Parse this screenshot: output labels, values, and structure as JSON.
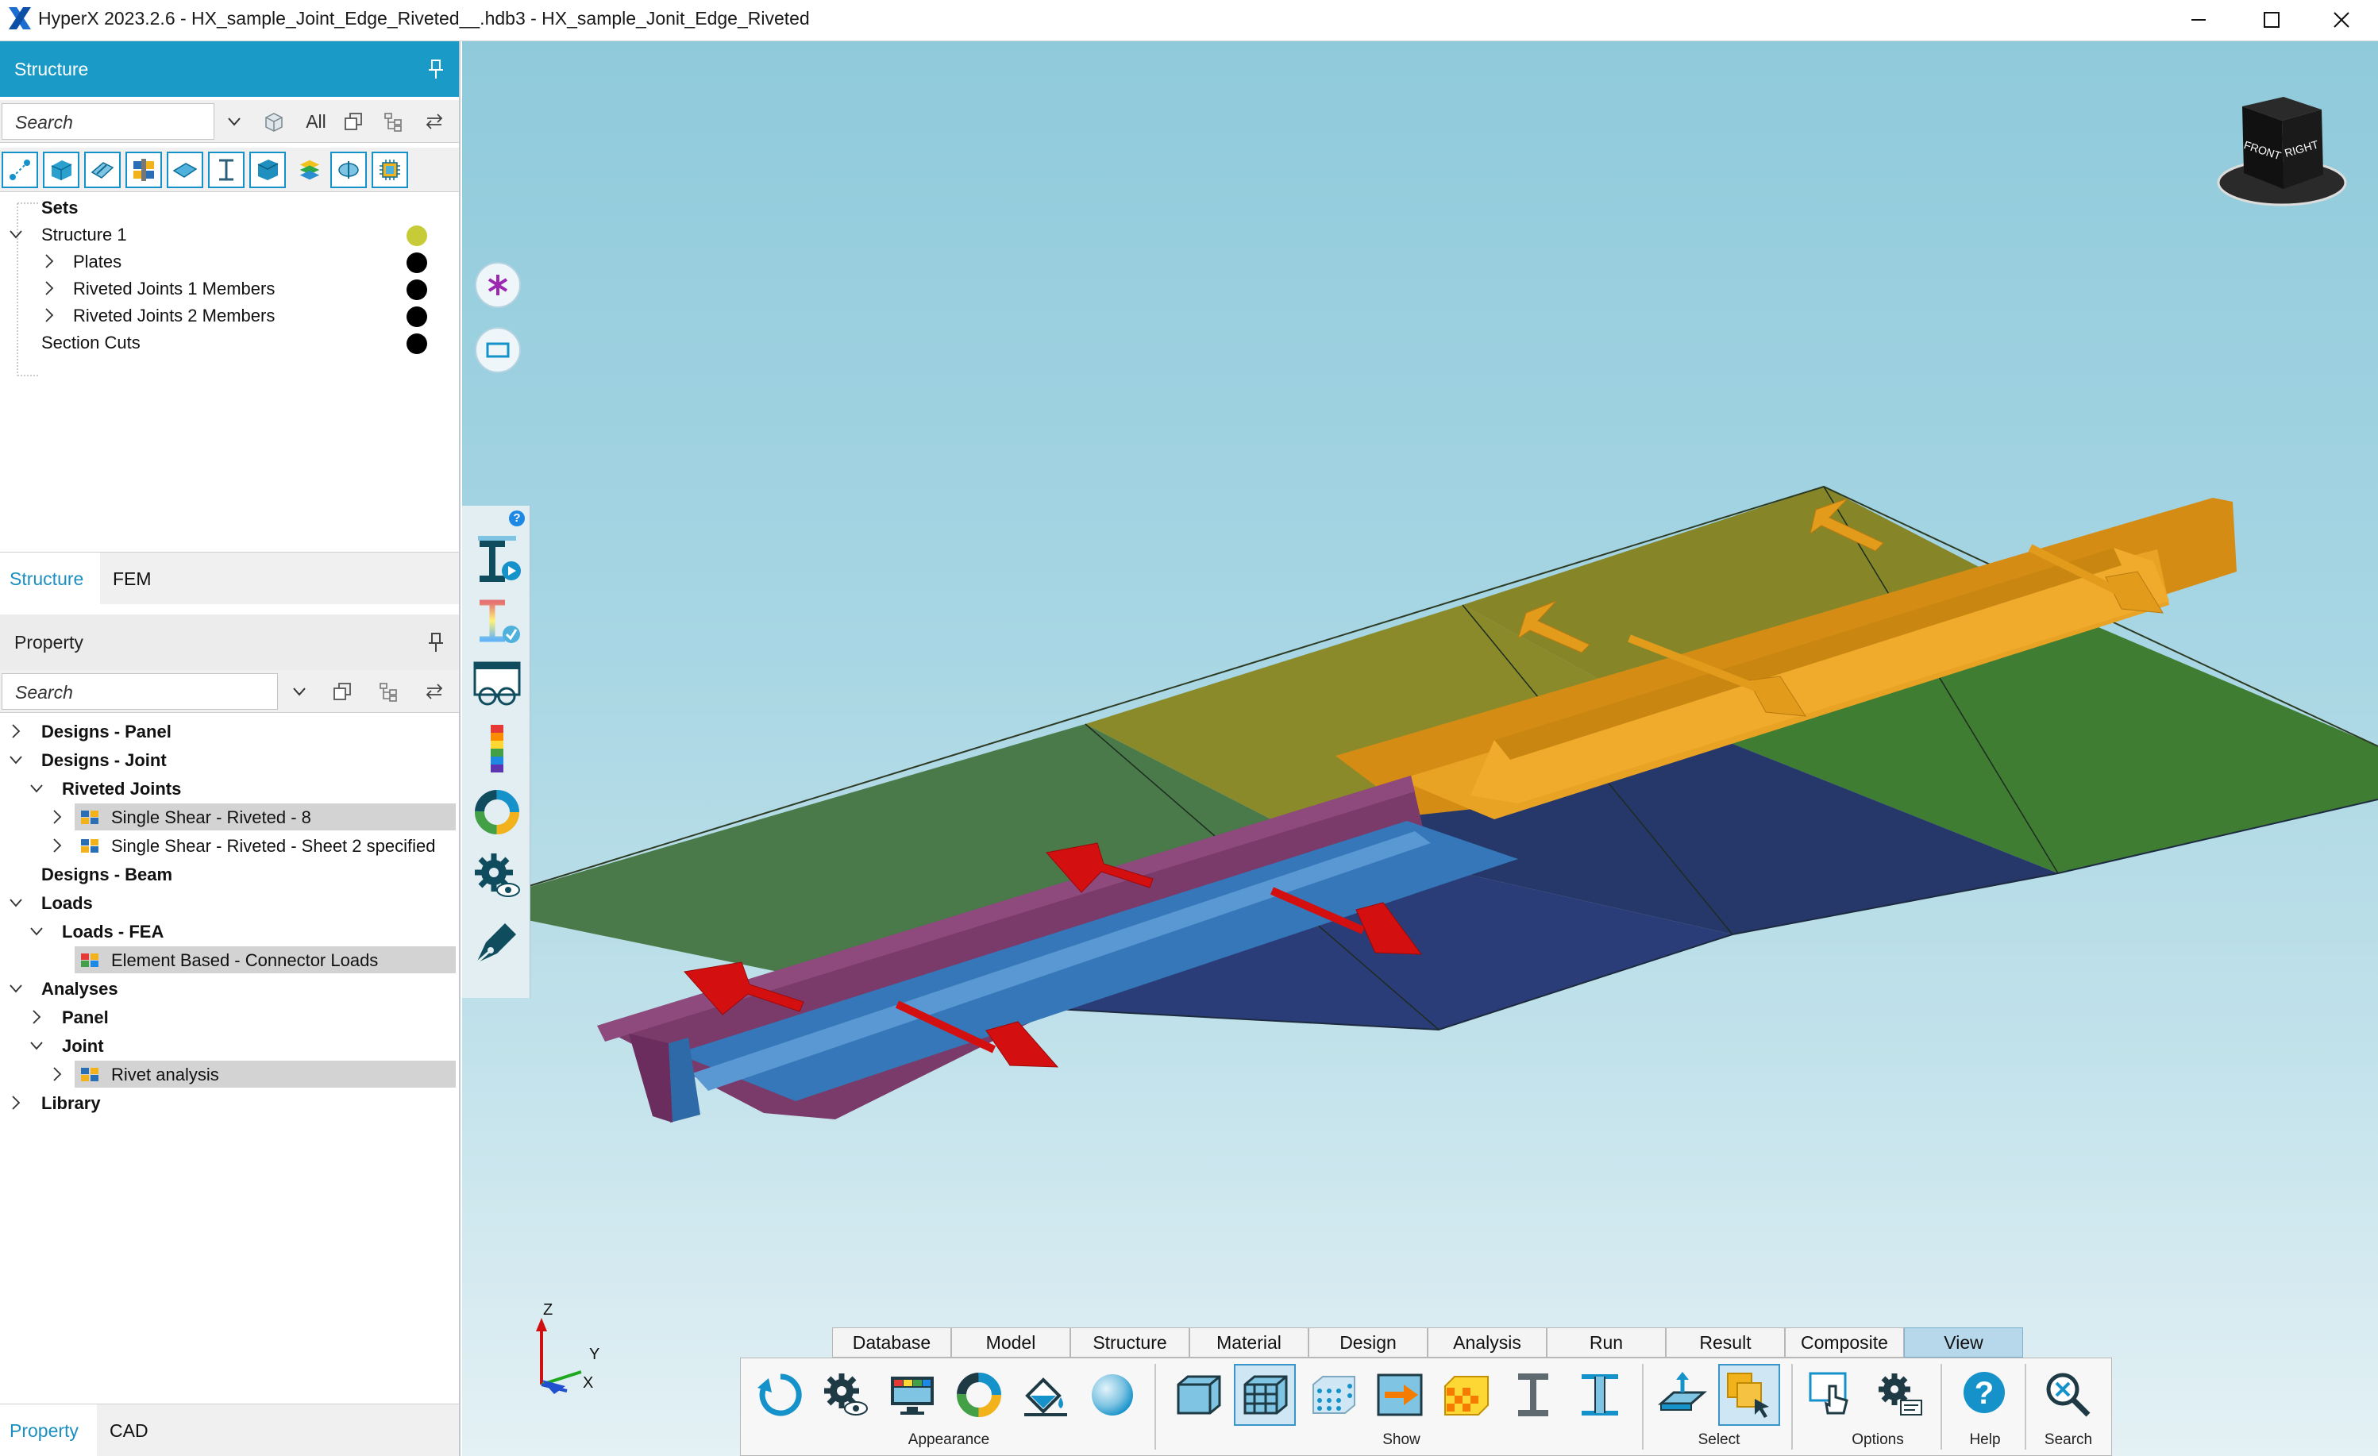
{
  "window": {
    "title": "HyperX 2023.2.6 - HX_sample_Joint_Edge_Riveted__.hdb3 - HX_sample_Jonit_Edge_Riveted"
  },
  "structure_panel": {
    "header": "Structure",
    "search_placeholder": "Search",
    "filter_all": "All",
    "tree": [
      {
        "label": "Sets"
      },
      {
        "label": "Structure 1"
      },
      {
        "label": "Plates"
      },
      {
        "label": "Riveted Joints 1 Members"
      },
      {
        "label": "Riveted Joints 2 Members"
      },
      {
        "label": "Section Cuts"
      }
    ],
    "tabs": [
      "Structure",
      "FEM"
    ]
  },
  "property_panel": {
    "header": "Property",
    "search_placeholder": "Search",
    "tree": [
      {
        "label": "Designs - Panel"
      },
      {
        "label": "Designs - Joint"
      },
      {
        "label": "Riveted Joints"
      },
      {
        "label": "Single Shear - Riveted - 8"
      },
      {
        "label": "Single Shear - Riveted - Sheet 2 specified"
      },
      {
        "label": "Designs - Beam"
      },
      {
        "label": "Loads"
      },
      {
        "label": "Loads - FEA"
      },
      {
        "label": "Element Based - Connector Loads"
      },
      {
        "label": "Analyses"
      },
      {
        "label": "Panel"
      },
      {
        "label": "Joint"
      },
      {
        "label": "Rivet analysis"
      },
      {
        "label": "Library"
      }
    ],
    "tabs": [
      "Property",
      "CAD"
    ]
  },
  "viewport": {
    "view_cube": {
      "front": "FRONT",
      "right": "RIGHT"
    },
    "axes": {
      "z": "Z",
      "y": "Y",
      "x": "X"
    },
    "colors": {
      "plate_dark_green": "#4a7a49",
      "plate_olive": "#8a8a2a",
      "plate_green": "#3f7d33",
      "plate_navy": "#26376a",
      "stiffener_orange": "#e29a1c",
      "stiffener_purple": "#7a3a6a",
      "stiffener_blue": "#3577b8",
      "load_arrow_red": "#d40f0f"
    }
  },
  "ribbon": {
    "tabs": [
      "Database",
      "Model",
      "Structure",
      "Material",
      "Design",
      "Analysis",
      "Run",
      "Result",
      "Composite",
      "View"
    ],
    "active_tab": "View",
    "groups": [
      "Appearance",
      "Show",
      "Select",
      "Options",
      "Help",
      "Search"
    ]
  }
}
